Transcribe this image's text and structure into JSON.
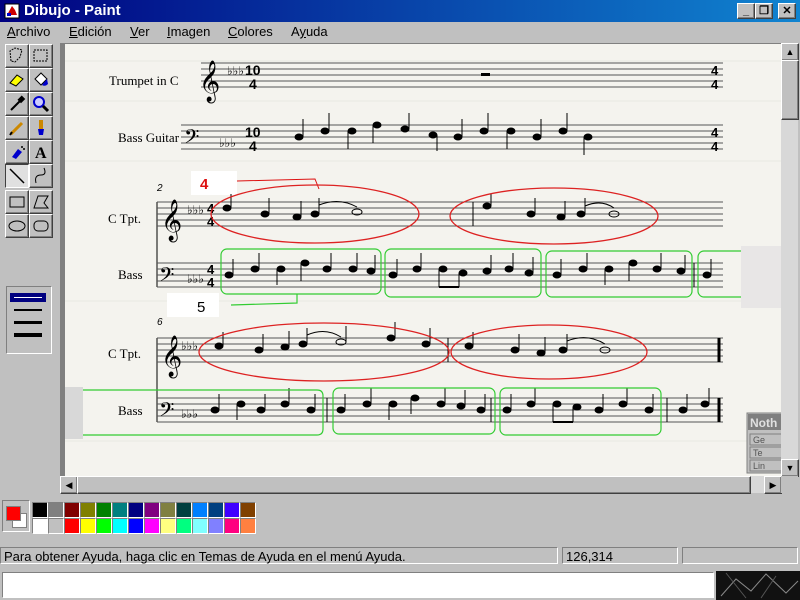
{
  "window": {
    "title": "Dibujo - Paint",
    "minimize": "_",
    "restore": "❐",
    "close": "✕"
  },
  "menu": [
    {
      "label": "Archivo",
      "underline": "A",
      "rest": "rchivo"
    },
    {
      "label": "Edición",
      "underline": "E",
      "rest": "dición"
    },
    {
      "label": "Ver",
      "underline": "V",
      "rest": "er"
    },
    {
      "label": "Imagen",
      "underline": "I",
      "rest": "magen"
    },
    {
      "label": "Colores",
      "underline": "C",
      "rest": "olores"
    },
    {
      "label": "Ayuda",
      "underline": "y",
      "rest": "uda",
      "prefix": "A"
    }
  ],
  "tools": [
    "free-form-select-icon",
    "rect-select-icon",
    "eraser-icon",
    "fill-bucket-icon",
    "color-picker-icon",
    "magnifier-icon",
    "pencil-icon",
    "brush-icon",
    "airbrush-icon",
    "text-icon",
    "line-icon",
    "curve-icon",
    "rectangle-icon",
    "polygon-icon",
    "ellipse-icon",
    "rounded-rect-icon"
  ],
  "active_tool": "line-icon",
  "canvas": {
    "labels": {
      "trumpet": "Trumpet in C",
      "bass_guitar": "Bass Guitar",
      "c_tpt_1": "C Tpt.",
      "bass_1": "Bass",
      "c_tpt_2": "C Tpt.",
      "bass_2": "Bass"
    },
    "measure_2": "2",
    "measure_6": "6",
    "annotation_4": "4",
    "annotation_5": "5",
    "time_sig_top": "10",
    "time_sig_bottom": "4",
    "time_sig_4": "4",
    "popup": {
      "title": "Noth",
      "items": [
        "Ge",
        "Te",
        "Lin"
      ]
    }
  },
  "palette": {
    "foreground": "#ff0000",
    "background": "#ffffff",
    "row1": [
      "#000000",
      "#808080",
      "#800000",
      "#808000",
      "#008000",
      "#008080",
      "#000080",
      "#800080",
      "#808040",
      "#004040",
      "#0080ff",
      "#004080",
      "#4000ff",
      "#804000"
    ],
    "row2": [
      "#ffffff",
      "#c0c0c0",
      "#ff0000",
      "#ffff00",
      "#00ff00",
      "#00ffff",
      "#0000ff",
      "#ff00ff",
      "#ffff80",
      "#00ff80",
      "#80ffff",
      "#8080ff",
      "#ff0080",
      "#ff8040"
    ]
  },
  "status": {
    "help": "Para obtener Ayuda, haga clic en Temas de Ayuda en el menú Ayuda.",
    "coords": "126,314"
  },
  "colors": {
    "red_annot": "#d11",
    "green_annot": "#3c3"
  }
}
